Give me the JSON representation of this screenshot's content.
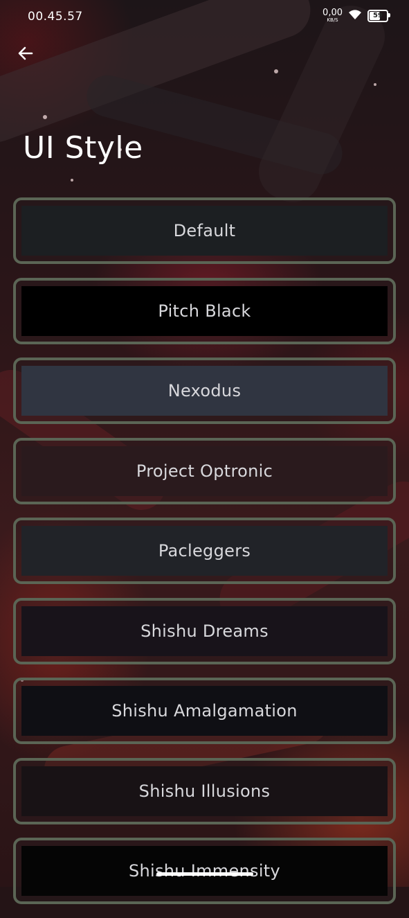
{
  "status_bar": {
    "time": "00.45.57",
    "net_speed_value": "0,00",
    "net_speed_unit": "KB/S",
    "battery_level": "59"
  },
  "header": {
    "back_icon": "arrow-left-icon",
    "title": "UI Style"
  },
  "style_options": [
    {
      "label": "Default",
      "color": "#1c1f22"
    },
    {
      "label": "Pitch Black",
      "color": "#000000"
    },
    {
      "label": "Nexodus",
      "color": "#303541"
    },
    {
      "label": "Project Optronic",
      "color": "#2a1a1d"
    },
    {
      "label": "Pacleggers",
      "color": "#212328"
    },
    {
      "label": "Shishu Dreams",
      "color": "#18131a"
    },
    {
      "label": "Shishu Amalgamation",
      "color": "#0f0f14"
    },
    {
      "label": "Shishu Illusions",
      "color": "#181215"
    },
    {
      "label": "Shishu Immensity",
      "color": "#050505"
    }
  ],
  "colors": {
    "option_border": "#5b6555",
    "option_text": "#d8d8dc"
  }
}
